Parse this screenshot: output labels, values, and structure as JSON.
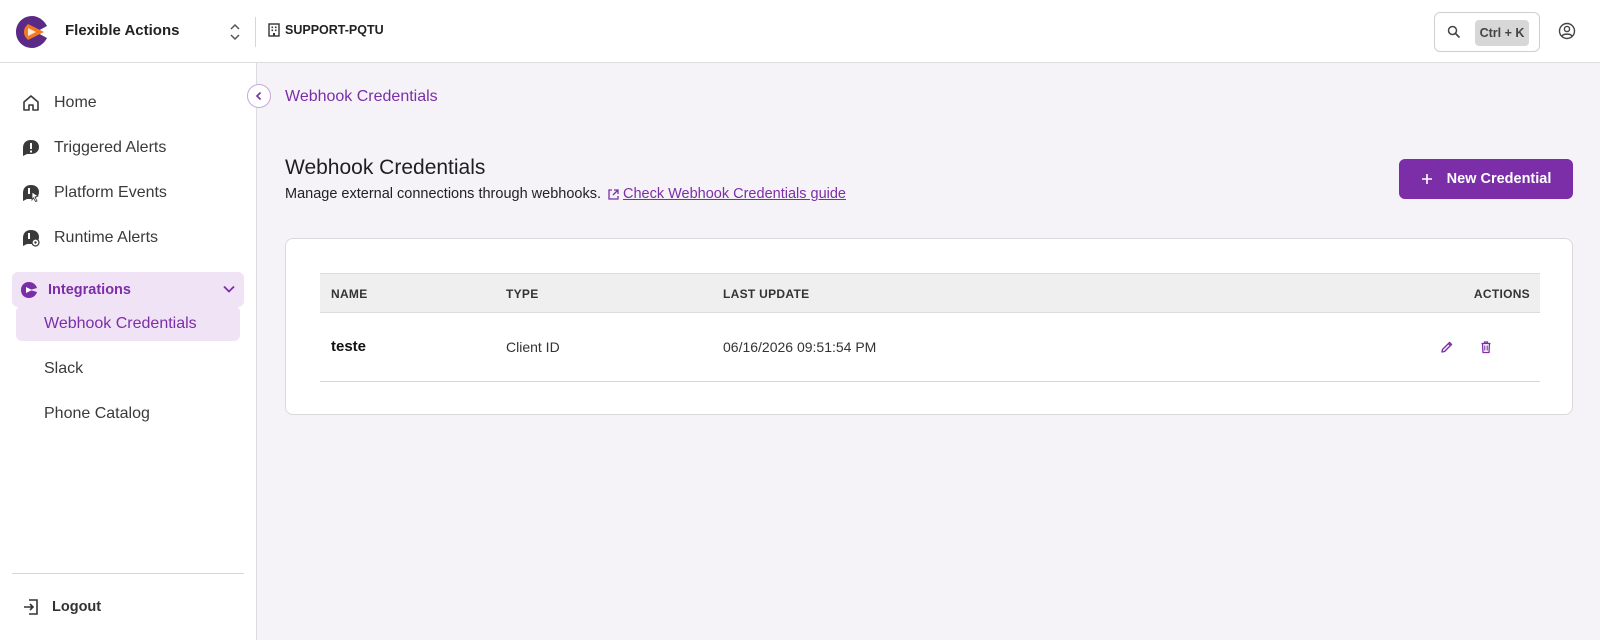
{
  "header": {
    "app_name": "Flexible Actions",
    "org_name": "SUPPORT-PQTU",
    "search_shortcut": "Ctrl + K"
  },
  "sidebar": {
    "items": [
      {
        "label": "Home",
        "icon": "home-icon"
      },
      {
        "label": "Triggered Alerts",
        "icon": "alert-icon"
      },
      {
        "label": "Platform Events",
        "icon": "event-icon"
      },
      {
        "label": "Runtime Alerts",
        "icon": "runtime-alert-icon"
      }
    ],
    "group": {
      "label": "Integrations",
      "expanded": true,
      "children": [
        {
          "label": "Webhook Credentials",
          "active": true
        },
        {
          "label": "Slack",
          "active": false
        },
        {
          "label": "Phone Catalog",
          "active": false
        }
      ]
    },
    "logout_label": "Logout"
  },
  "main": {
    "breadcrumb": "Webhook Credentials",
    "title": "Webhook Credentials",
    "subtitle": "Manage external connections through webhooks.",
    "guide_link": "Check Webhook Credentials guide",
    "new_button": "New Credential",
    "table": {
      "columns": [
        "NAME",
        "TYPE",
        "LAST UPDATE",
        "ACTIONS"
      ],
      "rows": [
        {
          "name": "teste",
          "type": "Client ID",
          "last_update": "06/16/2026 09:51:54 PM"
        }
      ]
    }
  },
  "colors": {
    "accent": "#7b2ea8",
    "accent_light": "#f1e3f6",
    "main_bg": "#f5f3f8"
  }
}
